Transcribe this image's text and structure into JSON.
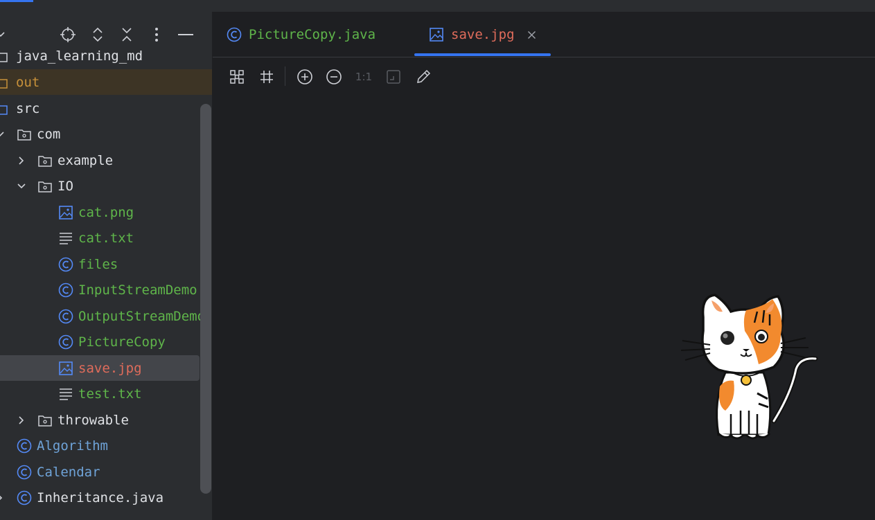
{
  "project_tree": {
    "items": [
      {
        "label": "java_learning_md",
        "color": "#dfe1e5"
      },
      {
        "label": "out",
        "color": "#c8913a"
      },
      {
        "label": "src",
        "color": "#dfe1e5"
      },
      {
        "label": "com",
        "color": "#dfe1e5"
      },
      {
        "label": "example",
        "color": "#dfe1e5"
      },
      {
        "label": "IO",
        "color": "#dfe1e5"
      },
      {
        "label": "cat.png",
        "color": "#5fb54a"
      },
      {
        "label": "cat.txt",
        "color": "#5fb54a"
      },
      {
        "label": "files",
        "color": "#5fb54a"
      },
      {
        "label": "InputStreamDemo",
        "color": "#5fb54a"
      },
      {
        "label": "OutputStreamDemo",
        "color": "#5fb54a"
      },
      {
        "label": "PictureCopy",
        "color": "#5fb54a"
      },
      {
        "label": "save.jpg",
        "color": "#e06c5b"
      },
      {
        "label": "test.txt",
        "color": "#5fb54a"
      },
      {
        "label": "throwable",
        "color": "#dfe1e5"
      },
      {
        "label": "Algorithm",
        "color": "#6fa3d8"
      },
      {
        "label": "Calendar",
        "color": "#6fa3d8"
      },
      {
        "label": "Inheritance.java",
        "color": "#dfe1e5"
      }
    ]
  },
  "tabs": [
    {
      "label": "PictureCopy.java",
      "active": false,
      "color": "#5fb54a"
    },
    {
      "label": "save.jpg",
      "active": true,
      "color": "#e06c5b"
    }
  ],
  "image_toolbar": {
    "actual_size_label": "1:1"
  },
  "icons": {
    "sidebar_toolbar": [
      "locate-icon",
      "expand-all-icon",
      "collapse-all-icon",
      "more-options-icon",
      "hide-icon"
    ],
    "image_toolbar": [
      "fit-to-window-icon",
      "grid-icon",
      "zoom-in-icon",
      "zoom-out-icon",
      "actual-size-icon",
      "chessboard-icon",
      "color-picker-icon"
    ]
  },
  "colors": {
    "accent": "#3574f0",
    "background": "#1e1f22",
    "panel": "#2b2d30",
    "selection": "#43454a"
  }
}
